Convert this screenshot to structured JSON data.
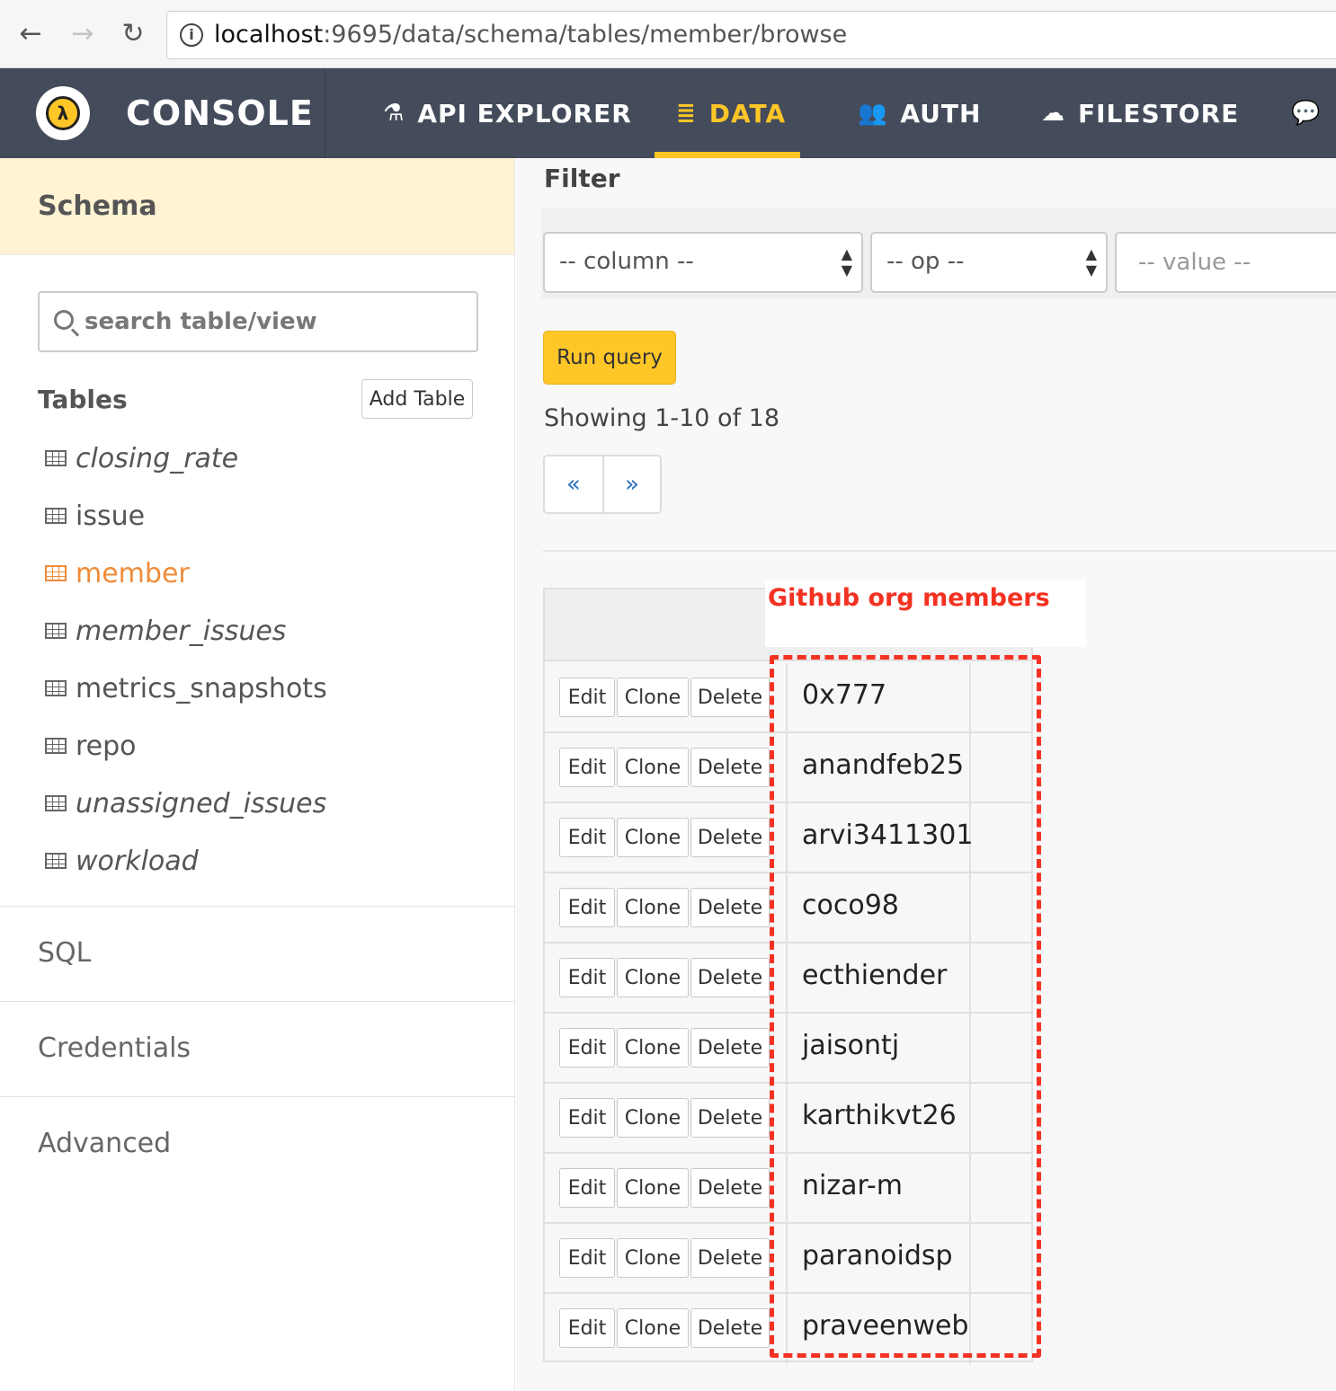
{
  "browser": {
    "url_host": "localhost",
    "url_path": ":9695/data/schema/tables/member/browse"
  },
  "header": {
    "brand": "CONSOLE",
    "nav": [
      {
        "label": "API EXPLORER",
        "icon": "flask-icon",
        "active": false
      },
      {
        "label": "DATA",
        "icon": "database-icon",
        "active": true
      },
      {
        "label": "AUTH",
        "icon": "users-icon",
        "active": false
      },
      {
        "label": "FILESTORE",
        "icon": "cloud-upload-icon",
        "active": false
      }
    ],
    "accent_color": "#ffc627"
  },
  "sidebar": {
    "schema_title": "Schema",
    "search_placeholder": "search table/view",
    "tables_label": "Tables",
    "add_table_label": "Add Table",
    "tables": [
      {
        "name": "closing_rate",
        "view": true
      },
      {
        "name": "issue",
        "view": false
      },
      {
        "name": "member",
        "view": false,
        "active": true
      },
      {
        "name": "member_issues",
        "view": true
      },
      {
        "name": "metrics_snapshots",
        "view": false
      },
      {
        "name": "repo",
        "view": false
      },
      {
        "name": "unassigned_issues",
        "view": true
      },
      {
        "name": "workload",
        "view": true
      }
    ],
    "sections": [
      "SQL",
      "Credentials",
      "Advanced"
    ]
  },
  "main": {
    "filter_title": "Filter",
    "column_select": "-- column --",
    "op_select": "-- op --",
    "value_placeholder": "-- value --",
    "run_query_label": "Run query",
    "showing": "Showing 1-10 of 18",
    "prev_label": "«",
    "next_label": "»",
    "annotation": "Github org members",
    "row_buttons": {
      "edit": "Edit",
      "clone": "Clone",
      "delete": "Delete"
    },
    "rows": [
      "0x777",
      "anandfeb25",
      "arvi3411301",
      "coco98",
      "ecthiender",
      "jaisontj",
      "karthikvt26",
      "nizar-m",
      "paranoidsp",
      "praveenweb"
    ]
  }
}
